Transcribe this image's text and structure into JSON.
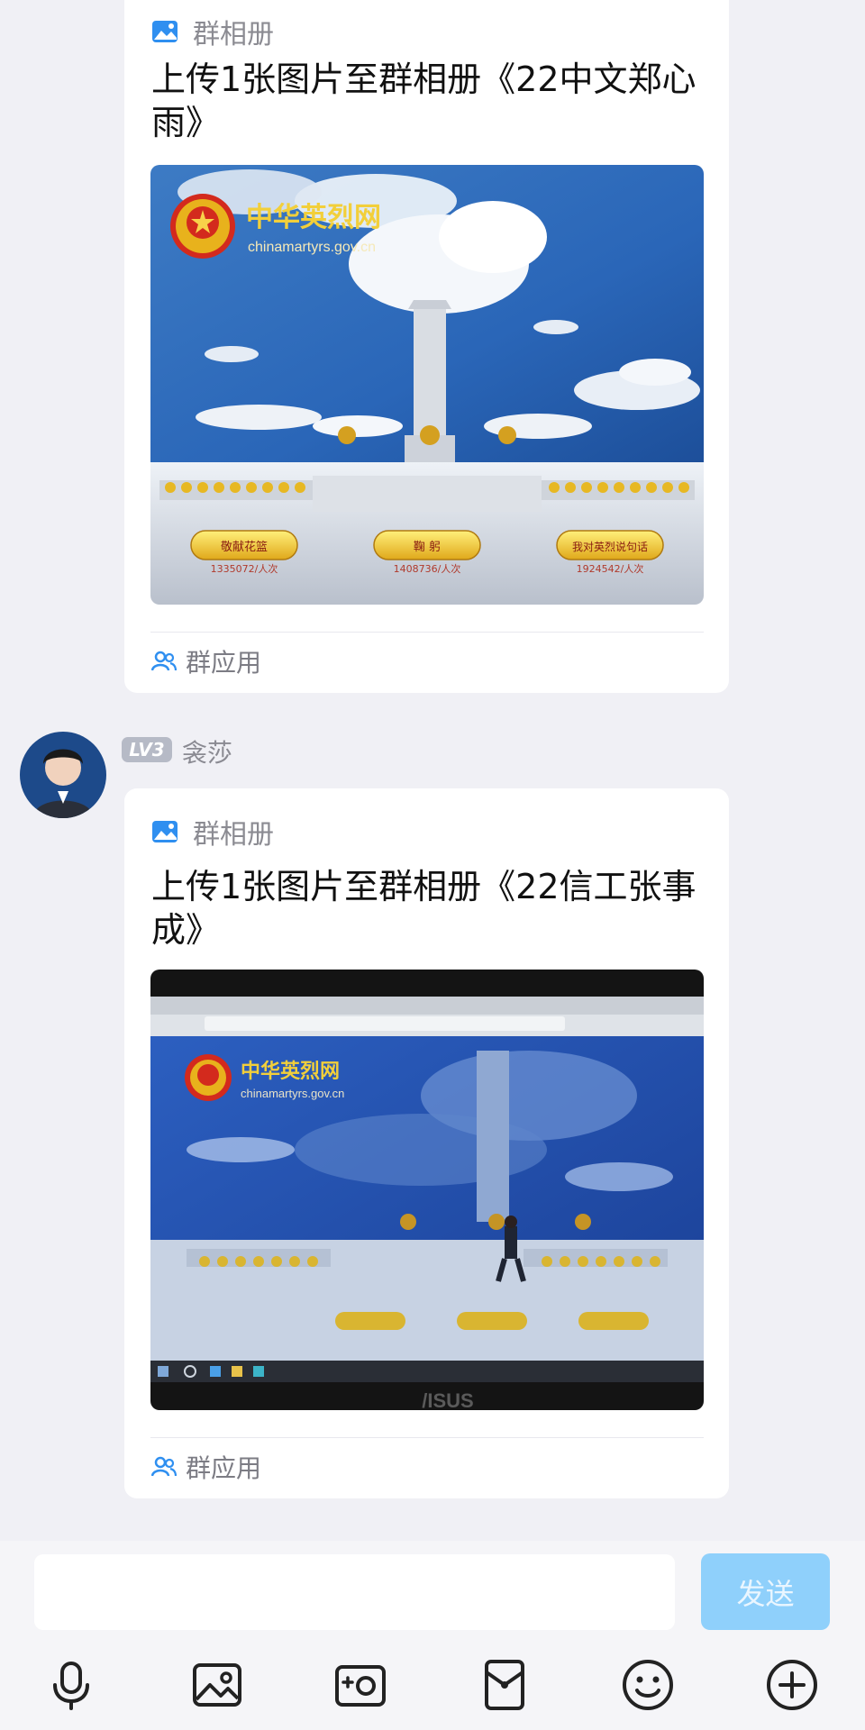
{
  "messages": [
    {
      "card_label": "群相册",
      "title": "上传1张图片至群相册《22中文郑心雨》",
      "photo": {
        "logo_name": "中华英烈网",
        "logo_url": "chinamartyrs.gov.cn",
        "buttons": [
          {
            "label": "敬献花篮",
            "count": "1335072/人次"
          },
          {
            "label": "鞠 躬",
            "count": "1408736/人次"
          },
          {
            "label": "我对英烈说句话",
            "count": "1924542/人次"
          }
        ]
      },
      "footer_label": "群应用"
    },
    {
      "sender": {
        "level": "LV3",
        "name": "衾莎"
      },
      "card_label": "群相册",
      "title": "上传1张图片至群相册《22信工张事成》",
      "photo": {
        "logo_name": "中华英烈网",
        "logo_url": "chinamartyrs.gov.cn",
        "laptop_brand": "/ISUS"
      },
      "footer_label": "群应用"
    }
  ],
  "input_bar": {
    "placeholder": "",
    "send_label": "发送",
    "tools": [
      "microphone-icon",
      "image-icon",
      "camera-icon",
      "red-packet-icon",
      "emoji-icon",
      "plus-icon"
    ]
  },
  "colors": {
    "accent": "#2f8ff0",
    "send_disabled": "#8fd0fb",
    "page_bg": "#f0f0f5"
  }
}
